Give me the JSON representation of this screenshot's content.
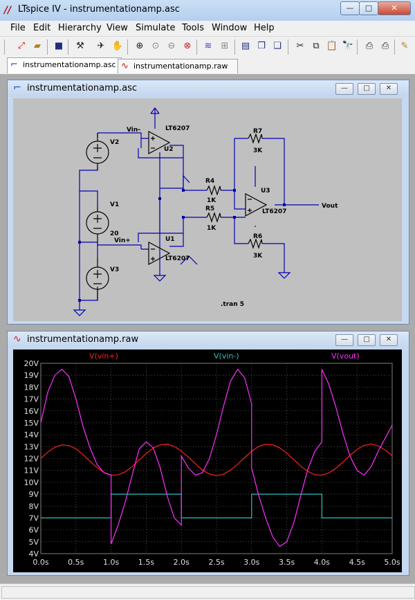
{
  "window": {
    "title": "LTspice IV - instrumentationamp.asc",
    "app_icon": "ltspice-icon",
    "controls": {
      "minimize": "—",
      "maximize": "□",
      "close": "✕"
    }
  },
  "menubar": {
    "items": [
      {
        "label": "File",
        "mnemonic": "F"
      },
      {
        "label": "Edit",
        "mnemonic": "E"
      },
      {
        "label": "Hierarchy",
        "mnemonic": "H"
      },
      {
        "label": "View",
        "mnemonic": "V"
      },
      {
        "label": "Simulate",
        "mnemonic": "S"
      },
      {
        "label": "Tools",
        "mnemonic": "T"
      },
      {
        "label": "Window",
        "mnemonic": "W"
      },
      {
        "label": "Help",
        "mnemonic": "H"
      }
    ]
  },
  "toolbar": {
    "icons": [
      "new-schematic-icon",
      "open-icon",
      "save-icon",
      "control-panel-icon",
      "run-icon",
      "halt-icon",
      "zoom-in-icon",
      "zoom-pan-icon",
      "zoom-out-icon",
      "zoom-cancel-icon",
      "autorange-icon",
      "fft-icon",
      "tile-horizontal-icon",
      "cascade-icon",
      "tile-vertical-icon",
      "cut-icon",
      "copy-icon",
      "paste-icon",
      "find-icon",
      "print-setup-icon",
      "print-icon",
      "edit-icon"
    ]
  },
  "tabs": [
    {
      "label": "instrumentationamp.asc",
      "icon": "schematic-icon",
      "active": true
    },
    {
      "label": "instrumentationamp.raw",
      "icon": "waveform-icon",
      "active": false
    }
  ],
  "schematic_window": {
    "title": "instrumentationamp.asc",
    "labels": {
      "vin_minus": "Vin-",
      "vin_plus": "Vin+",
      "vout": "Vout",
      "u2_model": "LT6207",
      "u2": "U2",
      "u1_model": "LT6207",
      "u1": "U1",
      "u3_model": "LT6207",
      "u3": "U3",
      "r7": "R7",
      "r7_val": "3K",
      "r4": "R4",
      "r4_val": "1K",
      "r5": "R5",
      "r5_val": "1K",
      "r6": "R6",
      "r6_val": "3K",
      "v2": "V2",
      "v1": "V1",
      "v1_val": "20",
      "v3": "V3",
      "directive": ".tran 5"
    },
    "colors": {
      "wire": "#0000b0",
      "background": "#c0c0c0",
      "component": "#000000"
    }
  },
  "waveform_window": {
    "title": "instrumentationamp.raw",
    "colors": {
      "background": "#000000",
      "grid": "#808080",
      "axis_text": "#e0e0e0"
    }
  },
  "chart_data": {
    "type": "line",
    "xlabel": "",
    "ylabel": "",
    "xlim": [
      0,
      5
    ],
    "ylim": [
      4,
      20
    ],
    "x_ticks": [
      "0.0s",
      "0.5s",
      "1.0s",
      "1.5s",
      "2.0s",
      "2.5s",
      "3.0s",
      "3.5s",
      "4.0s",
      "4.5s",
      "5.0s"
    ],
    "y_ticks": [
      "4V",
      "5V",
      "6V",
      "7V",
      "8V",
      "9V",
      "10V",
      "11V",
      "12V",
      "13V",
      "14V",
      "15V",
      "16V",
      "17V",
      "18V",
      "19V",
      "20V"
    ],
    "grid": true,
    "series": [
      {
        "name": "V(vin+)",
        "color": "#ff2020",
        "x": [
          0.0,
          0.1,
          0.2,
          0.3,
          0.4,
          0.5,
          0.6,
          0.7,
          0.8,
          0.9,
          1.0,
          1.1,
          1.2,
          1.3,
          1.4,
          1.5,
          1.6,
          1.7,
          1.8,
          1.9,
          2.0,
          2.1,
          2.2,
          2.3,
          2.4,
          2.5,
          2.6,
          2.7,
          2.8,
          2.9,
          3.0,
          3.1,
          3.2,
          3.3,
          3.4,
          3.5,
          3.6,
          3.7,
          3.8,
          3.9,
          4.0,
          4.1,
          4.2,
          4.3,
          4.4,
          4.5,
          4.6,
          4.7,
          4.8,
          4.9,
          5.0
        ],
        "y": [
          12.0,
          12.54,
          12.94,
          13.14,
          13.09,
          12.81,
          12.33,
          11.77,
          11.23,
          10.82,
          10.6,
          10.62,
          10.88,
          11.32,
          11.87,
          12.42,
          12.88,
          13.15,
          13.2,
          13.01,
          12.63,
          12.11,
          11.55,
          11.03,
          10.69,
          10.56,
          10.68,
          11.02,
          11.52,
          12.08,
          12.61,
          13.0,
          13.19,
          13.15,
          12.89,
          12.45,
          11.9,
          11.35,
          10.91,
          10.63,
          10.59,
          10.79,
          11.18,
          11.7,
          12.26,
          12.76,
          13.1,
          13.21,
          13.06,
          12.72,
          12.23
        ]
      },
      {
        "name": "V(vin-)",
        "color": "#30c0c0",
        "x": [
          0.0,
          1.0,
          1.0,
          2.0,
          2.0,
          3.0,
          3.0,
          4.0,
          4.0,
          5.0
        ],
        "y": [
          7.0,
          7.0,
          9.0,
          9.0,
          7.0,
          7.0,
          9.0,
          9.0,
          7.0,
          7.0
        ]
      },
      {
        "name": "V(vout)",
        "color": "#ff30ff",
        "x": [
          0.0,
          0.1,
          0.2,
          0.3,
          0.4,
          0.5,
          0.6,
          0.7,
          0.8,
          0.9,
          1.0,
          1.0,
          1.1,
          1.2,
          1.3,
          1.4,
          1.5,
          1.6,
          1.7,
          1.8,
          1.9,
          2.0,
          2.0,
          2.1,
          2.2,
          2.3,
          2.4,
          2.5,
          2.6,
          2.7,
          2.8,
          2.9,
          3.0,
          3.0,
          3.1,
          3.2,
          3.3,
          3.4,
          3.5,
          3.6,
          3.7,
          3.8,
          3.9,
          4.0,
          4.0,
          4.1,
          4.2,
          4.3,
          4.4,
          4.5,
          4.6,
          4.7,
          4.8,
          4.9,
          5.0
        ],
        "y": [
          15.0,
          17.6,
          19.0,
          19.5,
          18.9,
          17.0,
          14.7,
          12.9,
          11.5,
          10.8,
          10.6,
          4.8,
          6.4,
          8.3,
          10.6,
          12.8,
          13.4,
          12.9,
          11.2,
          8.8,
          7.0,
          6.4,
          12.2,
          11.2,
          10.6,
          10.8,
          12.0,
          14.0,
          16.4,
          18.5,
          19.5,
          18.8,
          16.6,
          11.2,
          8.9,
          7.0,
          5.4,
          4.6,
          5.0,
          6.6,
          8.9,
          11.1,
          12.6,
          13.4,
          19.5,
          18.2,
          16.3,
          14.1,
          12.2,
          11.0,
          10.6,
          11.3,
          12.6,
          13.7,
          14.8
        ]
      }
    ]
  }
}
